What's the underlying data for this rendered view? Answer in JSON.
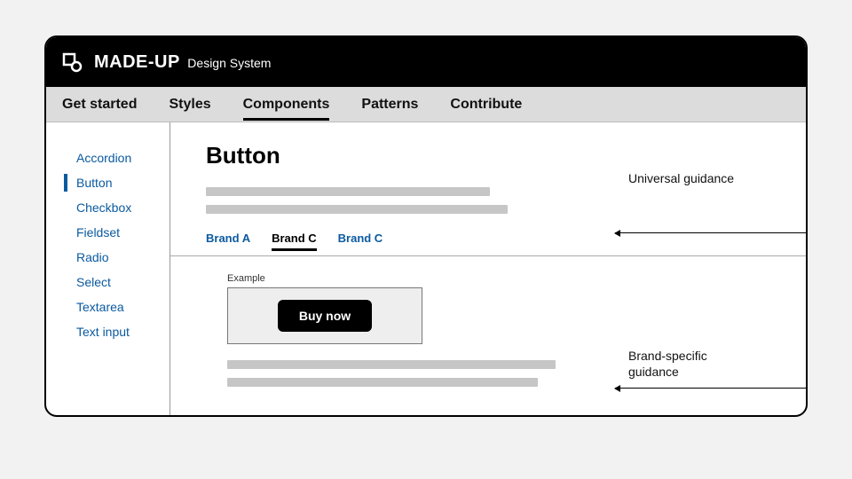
{
  "header": {
    "brand": "MADE-UP",
    "brand_sub": "Design System"
  },
  "nav": {
    "items": [
      "Get started",
      "Styles",
      "Components",
      "Patterns",
      "Contribute"
    ],
    "active_index": 2
  },
  "sidebar": {
    "items": [
      "Accordion",
      "Button",
      "Checkbox",
      "Fieldset",
      "Radio",
      "Select",
      "Textarea",
      "Text input"
    ],
    "active_index": 1
  },
  "page": {
    "title": "Button",
    "brand_tabs": [
      "Brand A",
      "Brand C",
      "Brand C"
    ],
    "brand_active_index": 1,
    "example_label": "Example",
    "example_button": "Buy now"
  },
  "annotations": {
    "universal": "Universal guidance",
    "brand_specific": "Brand-specific guidance"
  }
}
